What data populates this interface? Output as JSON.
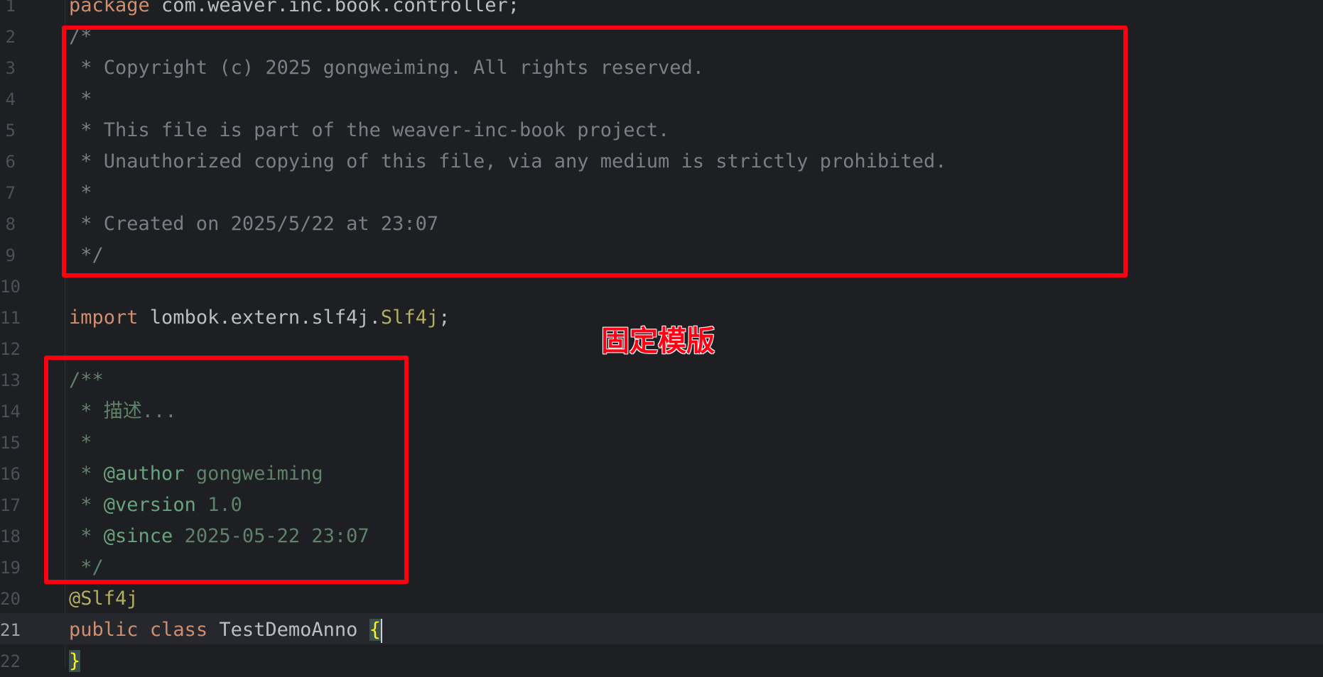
{
  "editor": {
    "language": "java",
    "active_line": "21",
    "line_numbers": [
      "1",
      "2",
      "3",
      "4",
      "5",
      "6",
      "7",
      "8",
      "9",
      "10",
      "11",
      "12",
      "13",
      "14",
      "15",
      "16",
      "17",
      "18",
      "19",
      "20",
      "21",
      "22"
    ],
    "lines": {
      "l1": {
        "kw": "package",
        "rest": " com.weaver.inc.book.controller;"
      },
      "l2": "/*",
      "l3": " * Copyright (c) 2025 gongweiming. All rights reserved.",
      "l4": " *",
      "l5": " * This file is part of the weaver-inc-book project.",
      "l6": " * Unauthorized copying of this file, via any medium is strictly prohibited.",
      "l7": " *",
      "l8": " * Created on 2025/5/22 at 23:07",
      "l9": " */",
      "l11": {
        "kw": "import",
        "pkg": " lombok.extern.slf4j.",
        "cls": "Slf4j",
        "end": ";"
      },
      "l13": "/**",
      "l14": " * 描述...",
      "l15": " *",
      "l16": {
        "prefix": " * ",
        "tag": "@author",
        "value": " gongweiming"
      },
      "l17": {
        "prefix": " * ",
        "tag": "@version",
        "value": " 1.0"
      },
      "l18": {
        "prefix": " * ",
        "tag": "@since",
        "value": " 2025-05-22 23:07"
      },
      "l19": " */",
      "l20": "@Slf4j",
      "l21": {
        "kw1": "public",
        "kw2": "class",
        "name": "TestDemoAnno",
        "brace": "{"
      },
      "l22": "}"
    }
  },
  "annotation": {
    "label": "固定模版",
    "box_color": "#ff0010"
  },
  "colors": {
    "background": "#1e1f22",
    "keyword": "#cf8e6d",
    "comment": "#7a7e85",
    "javadoc": "#5f826b",
    "annotation": "#b3ae60"
  }
}
